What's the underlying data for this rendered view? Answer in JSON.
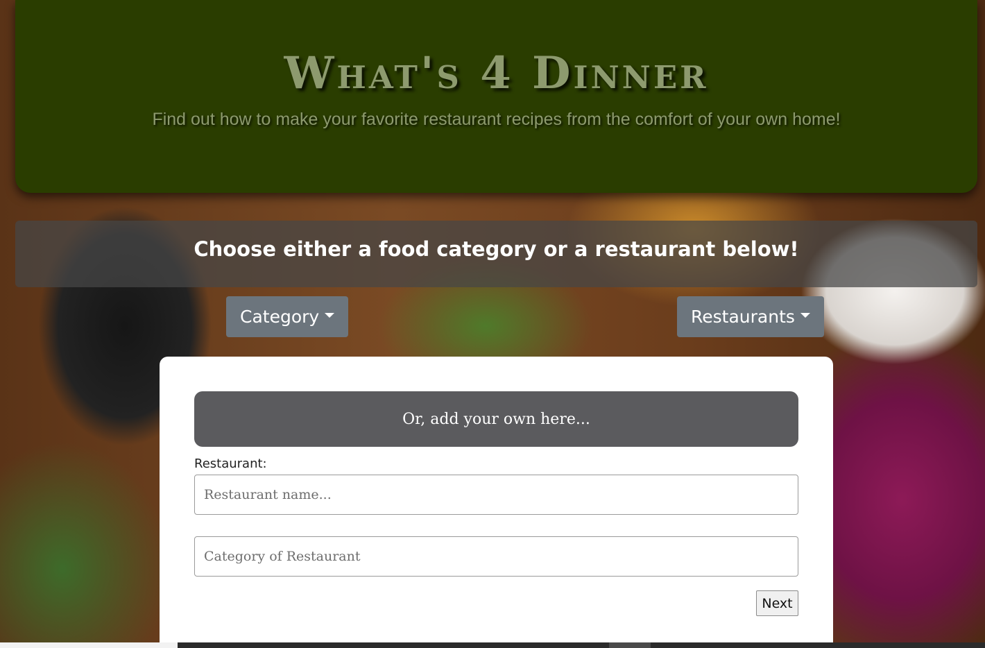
{
  "header": {
    "title": "What's 4 Dinner",
    "tagline": "Find out how to make your favorite restaurant recipes from the comfort of your own home!"
  },
  "instructions": {
    "text": "Choose either a food category or a restaurant below!"
  },
  "dropdowns": {
    "category_label": "Category",
    "restaurants_label": "Restaurants"
  },
  "add_form": {
    "banner_text": "Or, add your own here...",
    "restaurant_label": "Restaurant:",
    "restaurant_placeholder": "Restaurant name...",
    "category_placeholder": "Category of Restaurant",
    "next_label": "Next"
  },
  "colors": {
    "header_bg": "#2a3d00",
    "title_text": "#8d9a6e",
    "button_gray": "#6c757d",
    "banner_gray": "#5b5b5e"
  }
}
